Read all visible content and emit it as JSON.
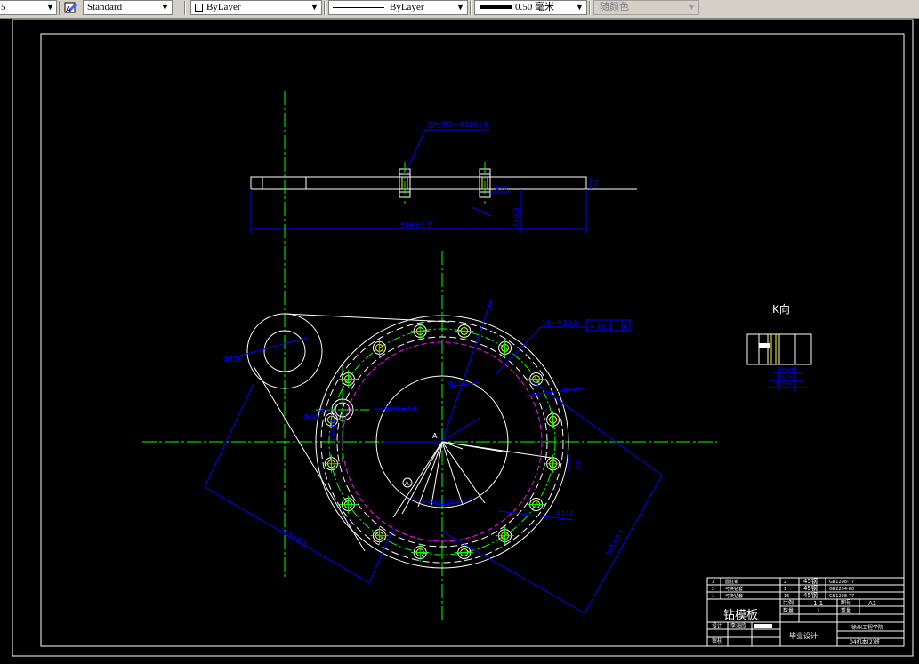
{
  "toolbar": {
    "dimstyle_value": "5",
    "textstyle_value": "Standard",
    "layer_value": "ByLayer",
    "linetype_value": "ByLayer",
    "lineweight_value": "0.50 毫米",
    "color_value": "随颜色"
  },
  "drawing": {
    "top_view": {
      "callout": "圆柱销2−Φ10X24",
      "dim_length": "596±0.7",
      "dim_height": "740.3",
      "dim_small": "Φ10",
      "dim_side": "15"
    },
    "main_view": {
      "hole_note": "16−Φ10.5",
      "tol_symbol": "⌖",
      "tol_value": "Φ0.3",
      "tol_datum": "A",
      "dim_d130": "Φ130",
      "dim_d30": "Φ30",
      "dim_r60": "Φ60±0.1",
      "dim_d242": "Φ242±0.1",
      "dim_d210": "Φ210",
      "dim_d305": "Φ305",
      "dim_d374": "Φ374",
      "dim_rot": "Φ2°",
      "dim_diag_left": "175±0.1",
      "dim_diag_right": "265±0.1",
      "center_label": "A",
      "datum_label": "A",
      "angle_note": "22.5°±0.1°"
    },
    "k_view": {
      "title": "K向",
      "dim_a": "Φ10(E)",
      "dim_b": "Φ12(H)",
      "dim_c": "Φ15(H)"
    }
  },
  "title_block": {
    "parts": [
      {
        "no": "3",
        "name": "圆柱销",
        "qty": "2",
        "mat": "45钢",
        "std": "GB1298-77"
      },
      {
        "no": "2",
        "name": "可换钻套",
        "qty": "1",
        "mat": "45钢",
        "std": "GB2264-80"
      },
      {
        "no": "1",
        "name": "可换钻套",
        "qty": "16",
        "mat": "45钢",
        "std": "GB1298-77"
      }
    ],
    "drawing_name": "钻模板",
    "scale_label": "比例",
    "scale_value": "1:1",
    "sheet_label": "图号",
    "sheet_value": "A1",
    "qty_label": "数量",
    "qty_value": "1",
    "weight_label": "重量",
    "designer_label": "设计",
    "designer_name": "李海欣",
    "checker_label": "审核",
    "project": "毕业设计",
    "school": "徐州工程学院",
    "class_name": "04机本(2)班"
  },
  "colors": {
    "background": "#000000",
    "geometry": "#ffffff",
    "centerline": "#00ff00",
    "dimension": "#0000ff",
    "hidden": "#ff00ff",
    "yellow": "#ffff00"
  }
}
